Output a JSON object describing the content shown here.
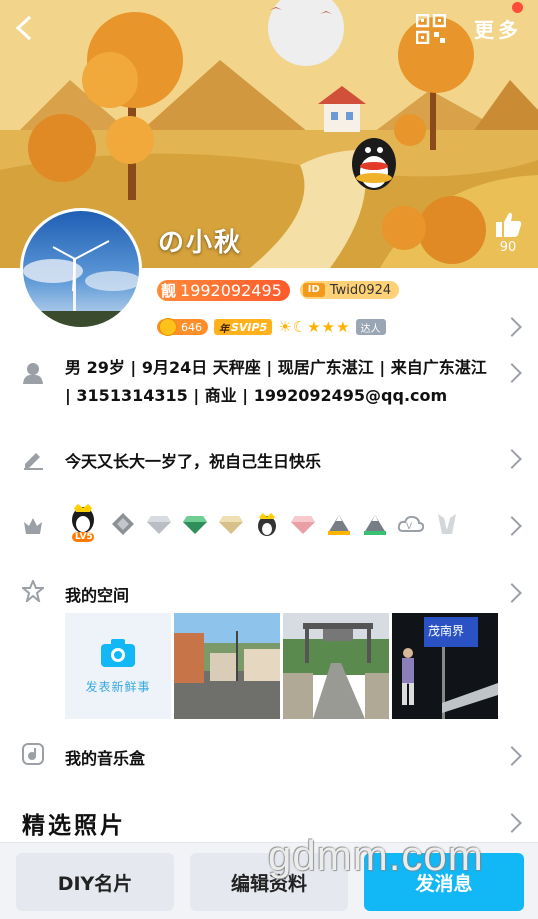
{
  "header": {
    "more_label": "更多",
    "like_count": "90"
  },
  "profile": {
    "nickname": "の小秋",
    "qq_badge": "靓",
    "qq_number": "1992092495",
    "qid": "Twid0924",
    "level_number": "646",
    "svip_year": "年",
    "svip_label": "SVIP5",
    "daren_label": "达人"
  },
  "info": {
    "text": "男 29岁 | 9月24日 天秤座 | 现居广东湛江 | 来自广东湛江 | 3151314315 | 商业 | 1992092495@qq.com"
  },
  "signature": "今天又长大一岁了，祝自己生日快乐",
  "medals": {
    "first_label": "LV5"
  },
  "space": {
    "title": "我的空间",
    "post_label": "发表新鲜事"
  },
  "music": {
    "title": "我的音乐盒"
  },
  "photos": {
    "title": "精选照片"
  },
  "buttons": {
    "diy": "DIY名片",
    "edit": "编辑资料",
    "message": "发消息"
  },
  "watermark": "gdmm.com",
  "colors": {
    "accent": "#12b7f5",
    "orange": "#ff6a2e"
  }
}
